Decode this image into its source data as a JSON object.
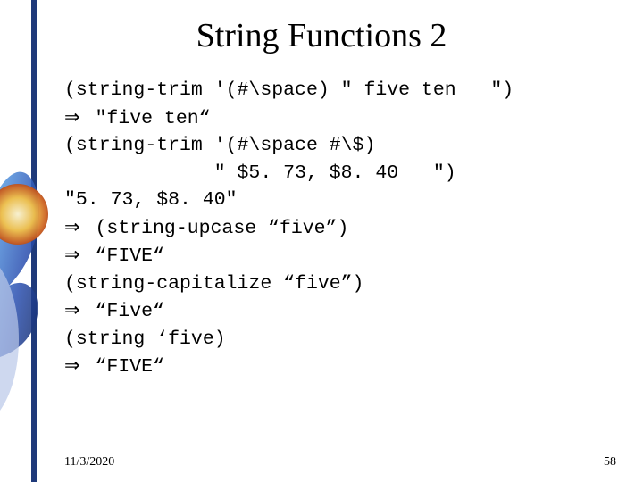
{
  "title": "String Functions 2",
  "arrow": "⇒",
  "code": {
    "l1": "(string-trim '(#\\space) \" five ten   \")",
    "l2_rest": " \"five ten“",
    "l3": "(string-trim '(#\\space #\\$)",
    "l4": "             \" $5. 73, $8. 40   \")",
    "l5": "\"5. 73, $8. 40\"",
    "l6_rest": " (string-upcase “five”)",
    "l7_rest": " “FIVE“",
    "l8": "(string-capitalize “five”)",
    "l9_rest": " “Five“",
    "l10": "(string ‘five)",
    "l11_rest": " “FIVE“"
  },
  "footer": {
    "date": "11/3/2020",
    "page": "58"
  }
}
